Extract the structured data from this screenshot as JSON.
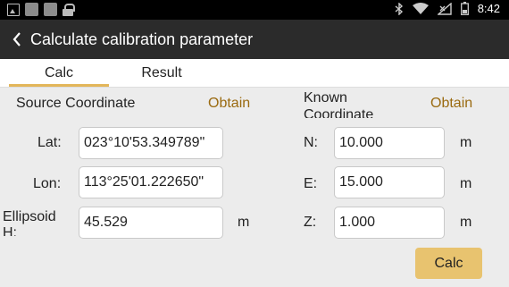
{
  "status_bar": {
    "time": "8:42"
  },
  "app_bar": {
    "title": "Calculate calibration parameter"
  },
  "tabs": [
    {
      "label": "Calc",
      "active": true
    },
    {
      "label": "Result",
      "active": false
    }
  ],
  "source": {
    "heading": "Source Coordinate",
    "obtain_label": "Obtain",
    "lat": {
      "label": "Lat:",
      "value": "023°10'53.349789\""
    },
    "lon": {
      "label": "Lon:",
      "value": "113°25'01.222650\""
    },
    "h": {
      "label": "Ellipsoid H:",
      "value": "45.529",
      "unit": "m"
    }
  },
  "known": {
    "heading": "Known Coordinate",
    "obtain_label": "Obtain",
    "n": {
      "label": "N:",
      "value": "10.000",
      "unit": "m"
    },
    "e": {
      "label": "E:",
      "value": "15.000",
      "unit": "m"
    },
    "z": {
      "label": "Z:",
      "value": "1.000",
      "unit": "m"
    }
  },
  "actions": {
    "calc_label": "Calc"
  },
  "colors": {
    "accent": "#e3b65a",
    "obtain_text": "#9a6a10",
    "appbar": "#2b2b2b",
    "button": "#e8c36f"
  }
}
